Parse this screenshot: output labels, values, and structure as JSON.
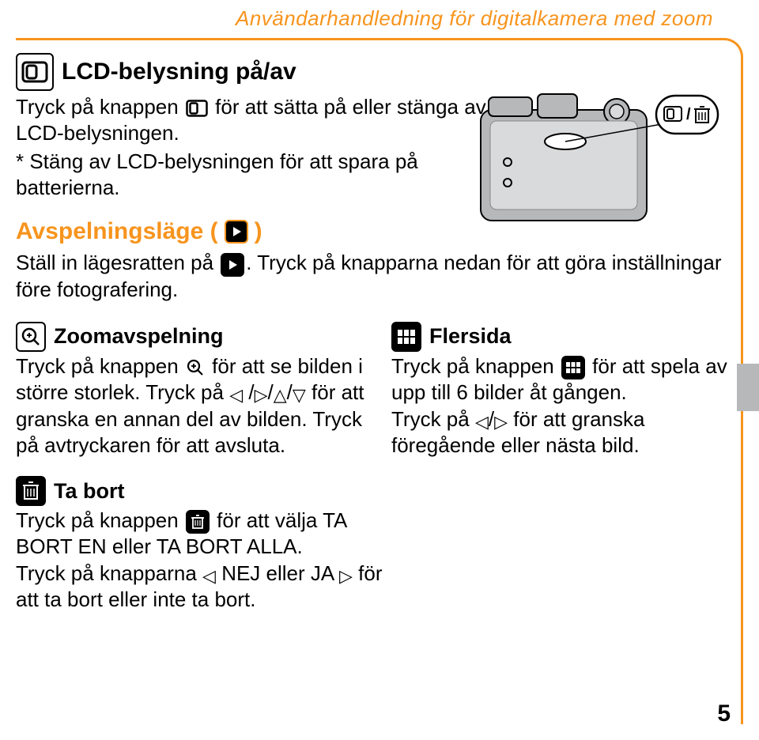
{
  "doc_title": "Användarhandledning för digitalkamera med zoom",
  "lcd": {
    "heading": "LCD-belysning på/av",
    "p1a": "Tryck på knappen ",
    "p1b": " för att sätta på eller stänga av LCD-belysningen.",
    "p2": "* Stäng av LCD-belysningen för att spara på batterierna."
  },
  "playback": {
    "heading_a": "Avspelningsläge (",
    "heading_b": ")",
    "p1a": "Ställ in lägesratten på ",
    "p1b": ". Tryck på knapparna nedan för att göra inställningar före fotografering."
  },
  "zoom": {
    "heading": "Zoomavspelning",
    "p_a": "Tryck på knappen ",
    "p_b": " för att se bilden i större storlek. Tryck på ",
    "p_c": " för att granska en annan del av bilden. Tryck på avtryckaren för att avsluta."
  },
  "multi": {
    "heading": "Flersida",
    "p_a": "Tryck på knappen ",
    "p_b": " för att spela av upp till 6 bilder åt gången.",
    "p2_a": "Tryck på ",
    "p2_b": " för att granska föregående eller nästa bild."
  },
  "delete": {
    "heading": "Ta bort",
    "p_a": "Tryck på knappen ",
    "p_b": " för att välja TA BORT EN eller TA BORT ALLA.",
    "p2_a": "Tryck på knapparna ",
    "p2_b": " NEJ eller JA ",
    "p2_c": " för att ta bort eller inte ta bort."
  },
  "page_number": "5"
}
